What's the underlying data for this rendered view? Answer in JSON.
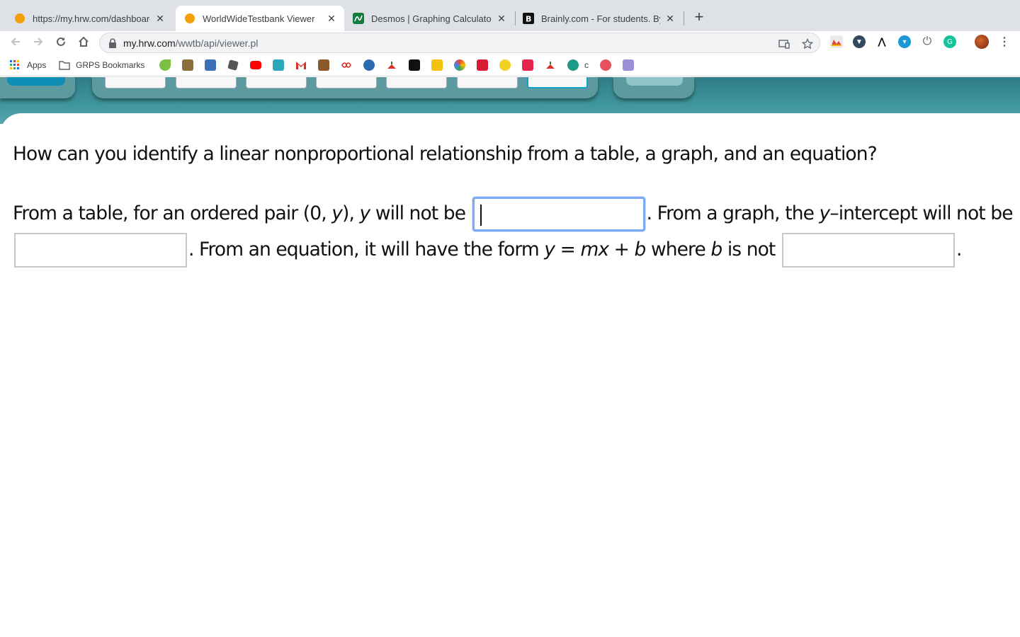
{
  "browser": {
    "tabs": [
      {
        "title": "https://my.hrw.com/dashboard",
        "close": "✕",
        "active": false,
        "favicon": "hrw-circle-icon"
      },
      {
        "title": "WorldWideTestbank Viewer",
        "close": "✕",
        "active": true,
        "favicon": "hrw-circle-icon"
      },
      {
        "title": "Desmos | Graphing Calculator",
        "close": "✕",
        "active": false,
        "favicon": "desmos-icon"
      },
      {
        "title": "Brainly.com - For students. By",
        "close": "✕",
        "active": false,
        "favicon": "brainly-icon"
      }
    ],
    "new_tab": "+",
    "url_host": "my.hrw.com",
    "url_path": "/wwtb/api/viewer.pl",
    "bookmarks": {
      "apps_label": "Apps",
      "folder_label": "GRPS Bookmarks",
      "c_label": "c"
    },
    "colors": {
      "tabstrip": "#dee1e6",
      "focus": "#7aa9f7",
      "band": "#3e949c"
    }
  },
  "question": {
    "title": "How can you identify a linear nonproportional relationship from a table, a graph, and an equation?",
    "p1": "From a table, for an ordered pair (0, ",
    "p1_var": "y",
    "p1b": "), ",
    "p1_var2": "y",
    "p1c": " will not be ",
    "p2": ". From a graph, the ",
    "p2_var": "y",
    "p2b": "–intercept will not be ",
    "p3": ". From an equation, it will have the form ",
    "eq_y": "y",
    "eq_eq": " = ",
    "eq_m": "m",
    "eq_x": "x",
    "eq_plus": " + ",
    "eq_b": "b",
    "p3b": " where ",
    "p3_var": "b",
    "p3c": " is not ",
    "p4": ".",
    "answers": [
      "",
      "",
      ""
    ]
  }
}
